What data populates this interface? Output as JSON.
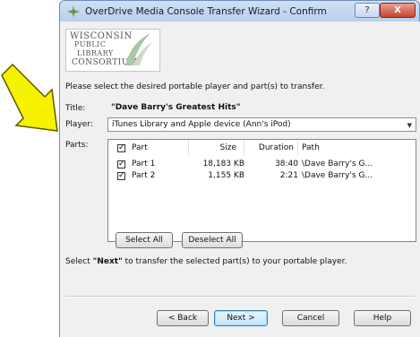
{
  "window": {
    "title": "OverDrive Media Console Transfer Wizard - Confirm",
    "help_glyph": "?",
    "close_glyph": "X"
  },
  "logo": {
    "line1": "WISCONSIN",
    "line2": "PUBLIC",
    "line3": "LIBRARY",
    "line4": "CONSORTIUM"
  },
  "instruction": "Please select the desired portable player and part(s) to transfer.",
  "fields": {
    "title_label": "Title:",
    "title_value": "\"Dave Barry's Greatest Hits\"",
    "player_label": "Player:",
    "player_value": "iTunes Library and Apple device (Ann's iPod)",
    "parts_label": "Parts:"
  },
  "parts": {
    "columns": {
      "part": "Part",
      "size": "Size",
      "duration": "Duration",
      "path": "Path"
    },
    "header_checked": true,
    "rows": [
      {
        "checked": true,
        "part": "Part 1",
        "size": "18,183 KB",
        "duration": "38:40",
        "path": "\\Dave Barry's G..."
      },
      {
        "checked": true,
        "part": "Part 2",
        "size": "1,155 KB",
        "duration": "2:21",
        "path": "\\Dave Barry's G..."
      }
    ]
  },
  "buttons": {
    "select_all": "Select All",
    "deselect_all": "Deselect All",
    "back": "< Back",
    "next": "Next >",
    "cancel": "Cancel",
    "help": "Help"
  },
  "next_hint": {
    "before": "Select ",
    "bold": "\"Next\"",
    "after": " to transfer the selected part(s) to your portable player."
  },
  "colors": {
    "arrow_fill": "#f6f200",
    "arrow_stroke": "#5a5a00",
    "dialog_bg": "#f0f0f0",
    "titlebar": "#c3d7ee"
  }
}
